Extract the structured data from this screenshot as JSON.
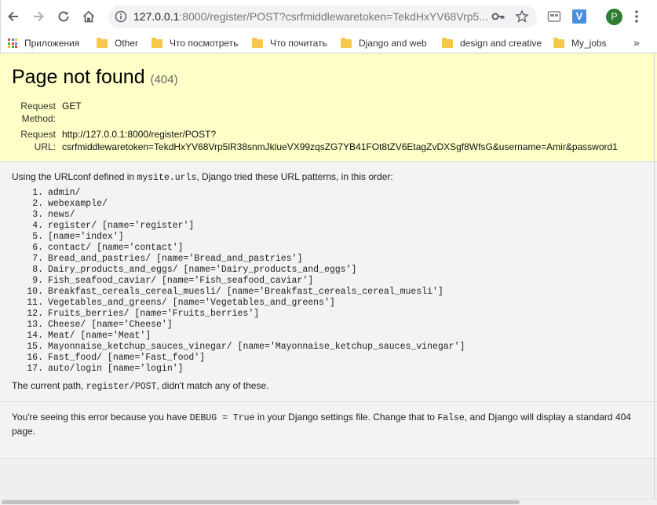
{
  "browser": {
    "url_host": "127.0.0.1",
    "url_rest": ":8000/register/POST?csrfmiddlewaretoken=TekdHxYV68Vrp5...",
    "extension_label": "V",
    "profile_initial": "P"
  },
  "bookmarks": {
    "apps": "Приложения",
    "items": [
      "Other",
      "Что посмотреть",
      "Что почитать",
      "Django and web",
      "design and creative",
      "My_jobs"
    ],
    "overflow": "»"
  },
  "error": {
    "title": "Page not found",
    "code": "(404)",
    "request_method_label_1": "Request",
    "request_method_label_2": "Method:",
    "request_method": "GET",
    "request_url_label_1": "Request",
    "request_url_label_2": "URL:",
    "request_url_line1": "http://127.0.0.1:8000/register/POST?",
    "request_url_line2": "csrfmiddlewaretoken=TekdHxYV68Vrp5lR38snmJklueVX99zqsZG7YB41FOt8tZV6EtagZvDXSgf8WfsG&username=Amir&password1"
  },
  "urlconf": {
    "intro_before": "Using the URLconf defined in ",
    "module": "mysite.urls",
    "intro_after": ", Django tried these URL patterns, in this order:",
    "patterns": [
      "admin/",
      "webexample/",
      "news/",
      "register/ [name='register']",
      "[name='index']",
      "contact/ [name='contact']",
      "Bread_and_pastries/ [name='Bread_and_pastries']",
      "Dairy_products_and_eggs/ [name='Dairy_products_and_eggs']",
      "Fish_seafood_caviar/ [name='Fish_seafood_caviar']",
      "Breakfast_cereals_cereal_muesli/ [name='Breakfast_cereals_cereal_muesli']",
      "Vegetables_and_greens/ [name='Vegetables_and_greens']",
      "Fruits_berries/ [name='Fruits_berries']",
      "Cheese/ [name='Cheese']",
      "Meat/ [name='Meat']",
      "Mayonnaise_ketchup_sauces_vinegar/ [name='Mayonnaise_ketchup_sauces_vinegar']",
      "Fast_food/ [name='Fast_food']",
      "auto/login [name='login']"
    ],
    "current_before": "The current path, ",
    "current_path": "register/POST",
    "current_after": ", didn't match any of these."
  },
  "explanation": {
    "part1": "You're seeing this error because you have ",
    "debug_code": "DEBUG = True",
    "part2": " in your Django settings file. Change that to ",
    "false_code": "False",
    "part3": ", and Django will display a standard 404 page."
  },
  "colors": {
    "summary_bg": "#ffffc8",
    "page_bg": "#f3f3f3"
  }
}
